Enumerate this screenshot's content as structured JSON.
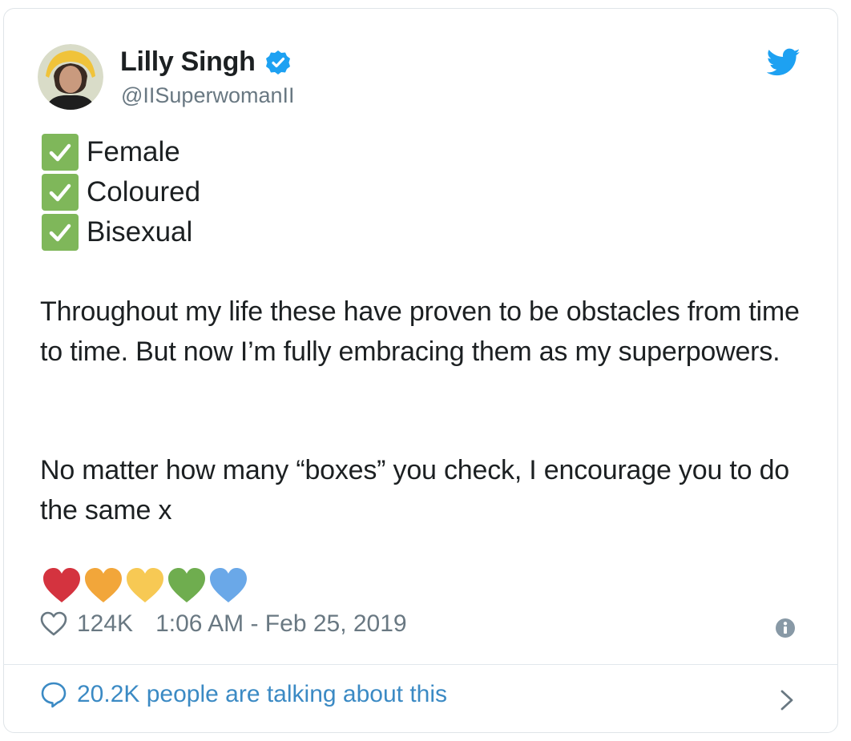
{
  "author": {
    "name": "Lilly Singh",
    "handle": "@IISuperwomanII",
    "verified": true
  },
  "icons": {
    "verified": "verified-badge-icon",
    "brand": "twitter-bird-icon",
    "like": "heart-outline-icon",
    "info": "info-icon",
    "replies": "speech-bubble-icon",
    "more": "chevron-right-icon",
    "check": "white-check-mark-icon"
  },
  "checklist": [
    "Female",
    "Coloured",
    "Bisexual"
  ],
  "body": {
    "paragraph1": "Throughout my life these have proven to be obstacles from time to time. But now I’m fully embracing them as my superpowers.",
    "paragraph2": "No matter how many “boxes” you check, I encourage you to do the same x"
  },
  "hearts": [
    {
      "name": "red-heart",
      "color": "#d4333f"
    },
    {
      "name": "orange-heart",
      "color": "#f2a63a"
    },
    {
      "name": "yellow-heart",
      "color": "#f7c954"
    },
    {
      "name": "green-heart",
      "color": "#6fad4f"
    },
    {
      "name": "blue-heart",
      "color": "#6aa8e8"
    }
  ],
  "footer": {
    "like_count": "124K",
    "timestamp": "1:06 AM - Feb 25, 2019",
    "talking": "20.2K people are talking about this"
  },
  "colors": {
    "brand_blue": "#1da1f2",
    "check_green": "#7fb75a",
    "link_blue": "#3b8ac4",
    "muted": "#697882"
  }
}
